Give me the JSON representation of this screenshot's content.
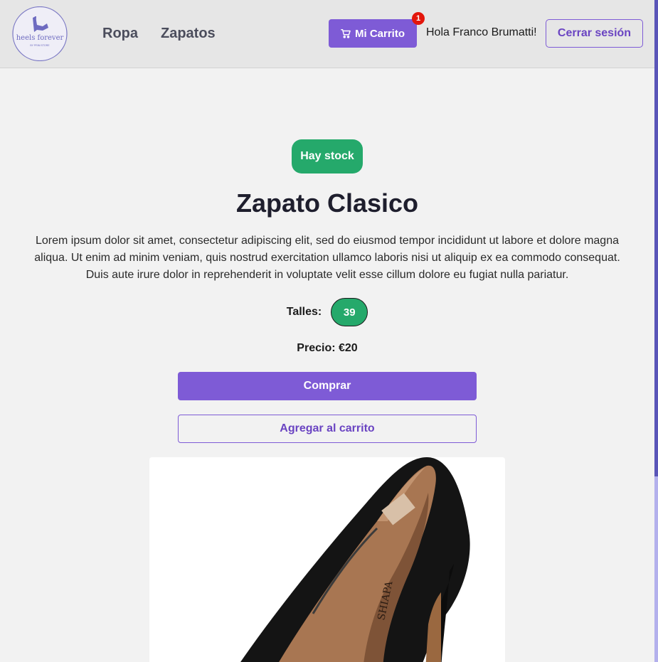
{
  "header": {
    "logo_text": "heels forever",
    "logo_subtext": "BY PRIM STORE",
    "nav": [
      {
        "label": "Ropa"
      },
      {
        "label": "Zapatos"
      }
    ],
    "cart_label": "Mi Carrito",
    "cart_count": "1",
    "greeting": "Hola Franco Brumatti!",
    "logout_label": "Cerrar sesión"
  },
  "product": {
    "stock_label": "Hay stock",
    "title": "Zapato Clasico",
    "description": "Lorem ipsum dolor sit amet, consectetur adipiscing elit, sed do eiusmod tempor incididunt ut labore et dolore magna aliqua. Ut enim ad minim veniam, quis nostrud exercitation ullamco laboris nisi ut aliquip ex ea commodo consequat. Duis aute irure dolor in reprehenderit in voluptate velit esse cillum dolore eu fugiat nulla pariatur.",
    "sizes_label": "Talles:",
    "sizes": [
      "39"
    ],
    "price_text": "Precio: €20",
    "buy_label": "Comprar",
    "add_to_cart_label": "Agregar al carrito",
    "image_alt": "black-high-heel-shoe"
  },
  "colors": {
    "accent": "#7e5bd6",
    "stock_green": "#25a96b",
    "badge_red": "#e3160b"
  },
  "icons": {
    "cart": "cart-icon"
  }
}
